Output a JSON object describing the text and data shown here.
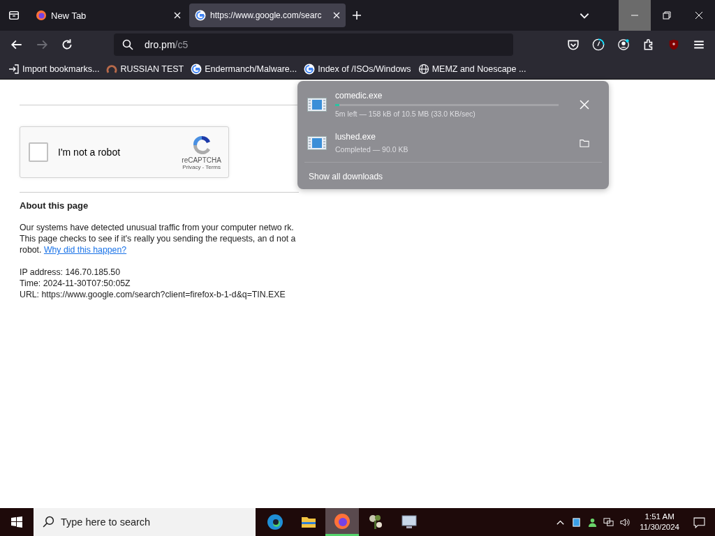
{
  "tabs": [
    {
      "kind": "firefox",
      "label": "New Tab",
      "selected": false
    },
    {
      "kind": "google",
      "label": "https://www.google.com/searc",
      "selected": true
    }
  ],
  "address_bar": {
    "host": "dro.pm",
    "path": "/c5"
  },
  "bookmarks": [
    {
      "kind": "import",
      "label": "Import bookmarks..."
    },
    {
      "kind": "ring",
      "label": "RUSSIAN TEST"
    },
    {
      "kind": "google",
      "label": "Endermanch/Malware..."
    },
    {
      "kind": "google",
      "label": "Index of /ISOs/Windows"
    },
    {
      "kind": "globe",
      "label": "MEMZ and Noescape ..."
    }
  ],
  "downloads": {
    "items": [
      {
        "kind": "progress",
        "name": "comedic.exe",
        "status": "5m left — 158 kB of 10.5 MB (33.0 KB/sec)",
        "level": 0.02
      },
      {
        "kind": "completed",
        "name": "lushed.exe",
        "status": "Completed — 90.0 KB"
      }
    ],
    "footer": "Show all downloads"
  },
  "captcha": {
    "label": "I'm not a robot",
    "checked": false,
    "brand": "reCAPTCHA",
    "privacy": "Privacy",
    "separator": "-",
    "terms": "Terms"
  },
  "about": {
    "heading": "About this page",
    "text": "Our systems have detected unusual traffic from your computer netwo rk. This page checks to see if it's really you sending the requests, an d not a robot.",
    "link": "Why did this happen?",
    "lines": [
      "IP address: 146.70.185.50",
      "Time: 2024-11-30T07:50:05Z",
      "URL: https://www.google.com/search?client=firefox-b-1-d&q=TIN.EXE"
    ]
  },
  "taskbar": {
    "search_placeholder": "Type here to search",
    "apps": [
      {
        "kind": "edge",
        "selected": false
      },
      {
        "kind": "folder",
        "selected": false
      },
      {
        "kind": "firefox",
        "selected": true
      },
      {
        "kind": "plant",
        "selected": false
      },
      {
        "kind": "monitor",
        "selected": false
      }
    ],
    "time": "1:51 AM",
    "date": "11/30/2024"
  }
}
